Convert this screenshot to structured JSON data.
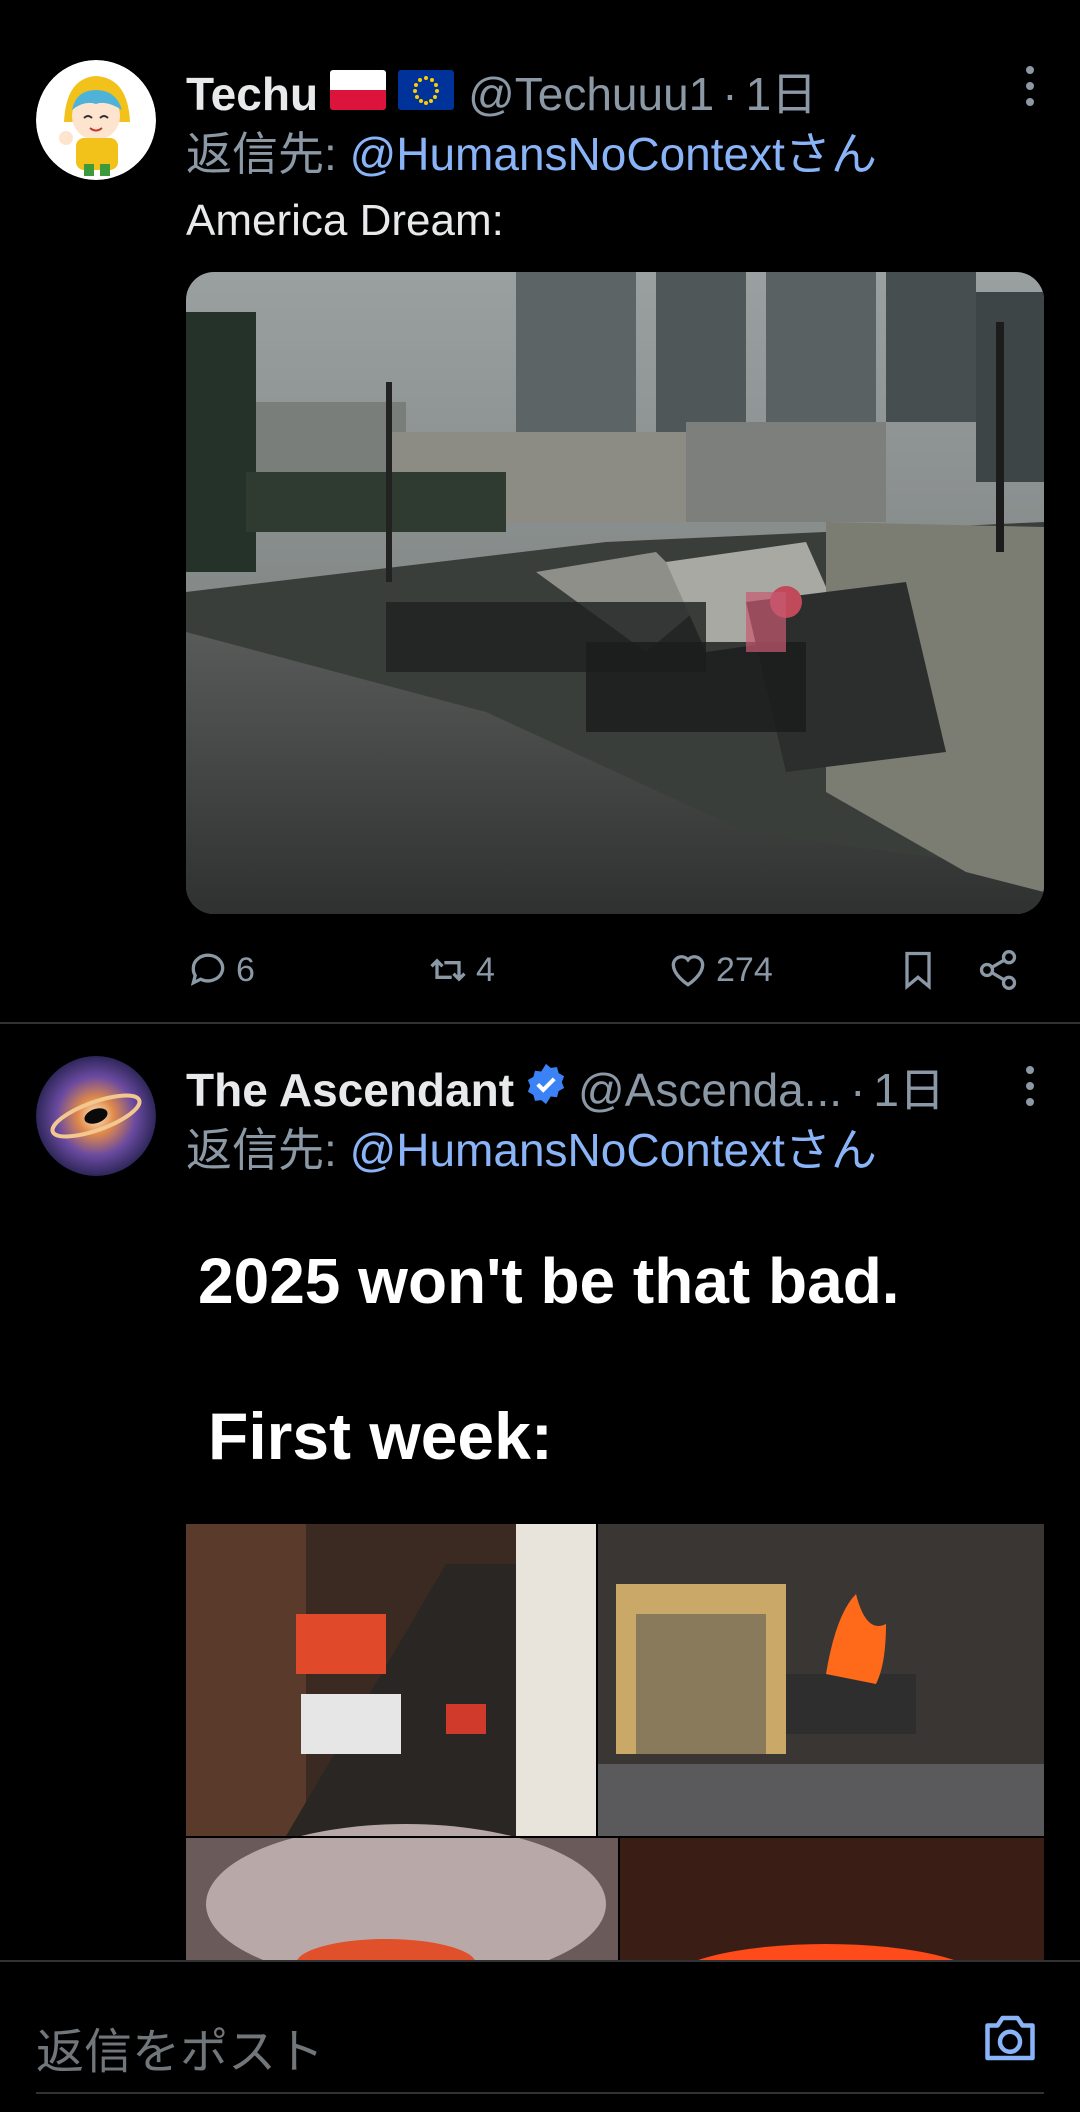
{
  "posts": [
    {
      "name": "Techu",
      "flags": [
        "poland-flag",
        "eu-flag"
      ],
      "handle": "@Techuuu1",
      "separator": "·",
      "time": "1日",
      "reply_prefix": "返信先:",
      "reply_mention": "@HumansNoContextさん",
      "text": "America Dream:",
      "image_desc": "homeless-encampment-photo",
      "stats": {
        "replies": "6",
        "reposts": "4",
        "likes": "274"
      }
    },
    {
      "name": "The Ascendant",
      "verified": true,
      "handle": "@Ascenda...",
      "separator": "·",
      "time": "1日",
      "reply_prefix": "返信先:",
      "reply_mention": "@HumansNoContextさん",
      "meme_line1": "2025 won't be that bad.",
      "meme_line2": "First week:"
    }
  ],
  "composer": {
    "placeholder": "返信をポスト"
  },
  "colors": {
    "background": "#000000",
    "mention": "#8ab4f8",
    "muted": "#8b98a5",
    "verified": "#3b82f6"
  }
}
